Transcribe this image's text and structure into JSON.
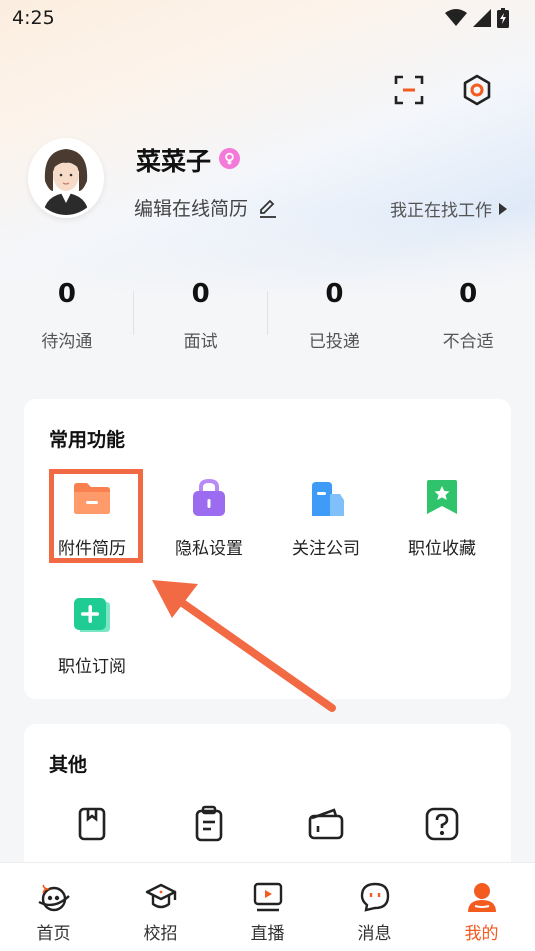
{
  "status_bar": {
    "time": "4:25"
  },
  "profile": {
    "name": "菜菜子",
    "edit_label": "编辑在线简历",
    "job_status": "我正在找工作"
  },
  "stats": [
    {
      "value": "0",
      "label": "待沟通"
    },
    {
      "value": "0",
      "label": "面试"
    },
    {
      "value": "0",
      "label": "已投递"
    },
    {
      "value": "0",
      "label": "不合适"
    }
  ],
  "common_functions": {
    "title": "常用功能",
    "items": [
      {
        "label": "附件简历",
        "icon": "folder-icon"
      },
      {
        "label": "隐私设置",
        "icon": "lock-icon"
      },
      {
        "label": "关注公司",
        "icon": "building-icon"
      },
      {
        "label": "职位收藏",
        "icon": "bookmark-star-icon"
      },
      {
        "label": "职位订阅",
        "icon": "add-subscription-icon"
      }
    ]
  },
  "other": {
    "title": "其他",
    "items": [
      {
        "icon": "bookmark-icon"
      },
      {
        "icon": "clipboard-icon"
      },
      {
        "icon": "wallet-icon"
      },
      {
        "icon": "help-icon"
      }
    ]
  },
  "bottom_nav": [
    {
      "label": "首页",
      "icon": "home-planet-icon"
    },
    {
      "label": "校招",
      "icon": "graduation-cap-icon"
    },
    {
      "label": "直播",
      "icon": "live-tv-icon"
    },
    {
      "label": "消息",
      "icon": "chat-icon"
    },
    {
      "label": "我的",
      "icon": "profile-icon",
      "active": true
    }
  ],
  "colors": {
    "accent": "#f35b1f",
    "highlight": "#f26a44"
  }
}
